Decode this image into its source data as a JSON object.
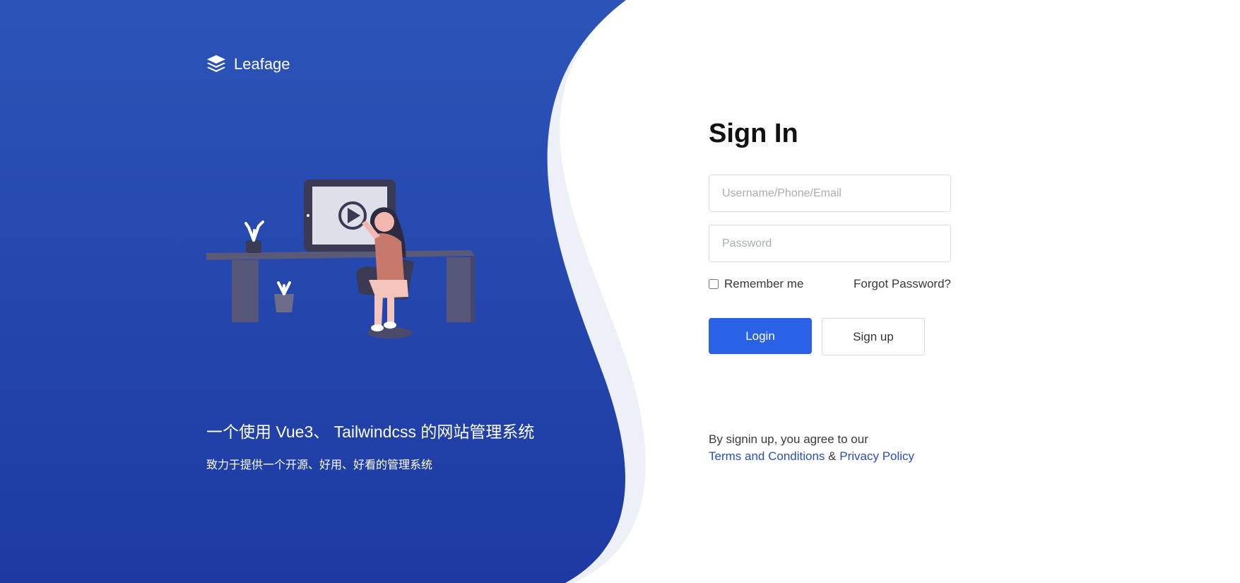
{
  "brand": {
    "name": "Leafage",
    "logo_icon": "layers-icon"
  },
  "hero": {
    "tagline": "一个使用 Vue3、 Tailwindcss 的网站管理系统",
    "subline": "致力于提供一个开源、好用、好看的管理系统",
    "illustration": "woman-at-desk-watching-video-illustration"
  },
  "form": {
    "title": "Sign In",
    "username_placeholder": "Username/Phone/Email",
    "password_placeholder": "Password",
    "remember_label": "Remember me",
    "remember_checked": false,
    "forgot_label": "Forgot Password?",
    "login_label": "Login",
    "signup_label": "Sign up"
  },
  "legal": {
    "prefix": "By signin up, you agree to our",
    "terms": "Terms and Conditions",
    "amp": "&",
    "privacy": "Privacy Policy"
  },
  "colors": {
    "panel_top": "#2c54b8",
    "panel_bottom": "#1d3aa2",
    "accent": "#2962e6",
    "link": "#2a4fb3"
  }
}
